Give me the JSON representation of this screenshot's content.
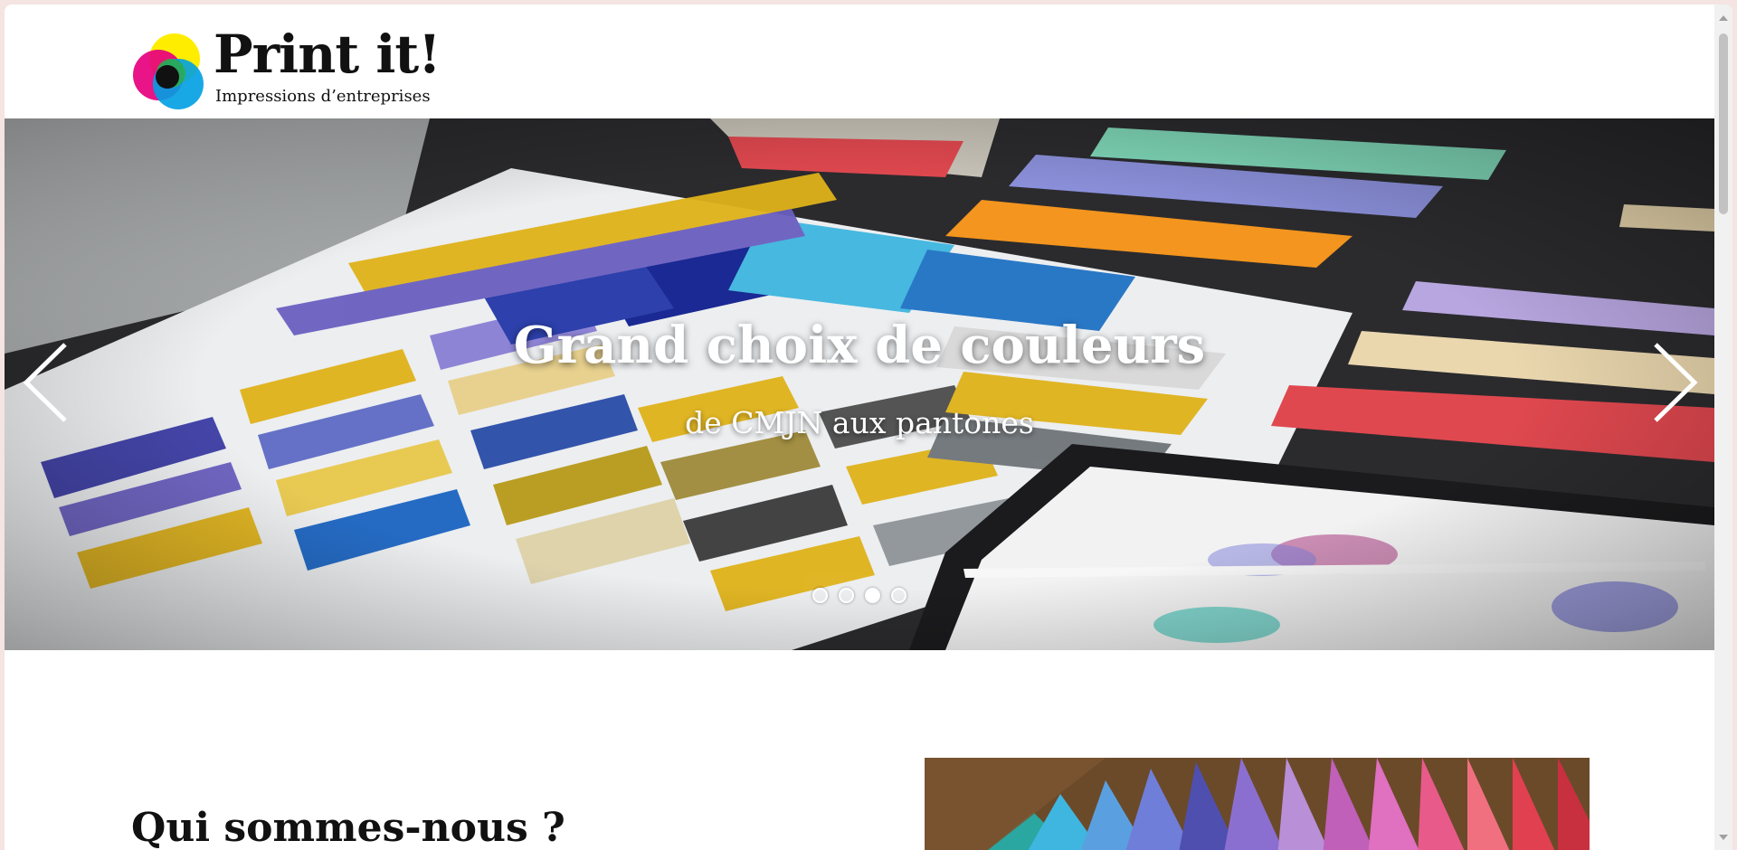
{
  "brand": {
    "name": "Print it!",
    "tagline": "Impressions d’entreprises",
    "logo_colors": [
      "#ffed00",
      "#e6007e",
      "#009fe3",
      "#2bae4a",
      "#111111"
    ]
  },
  "hero": {
    "slides_count": 4,
    "active_slide": 3,
    "title": "Grand choix de couleurs",
    "subtitle": "de CMJN aux pantones",
    "prev_icon": "chevron-left-icon",
    "next_icon": "chevron-right-icon"
  },
  "about": {
    "title": "Qui sommes-nous ?"
  }
}
